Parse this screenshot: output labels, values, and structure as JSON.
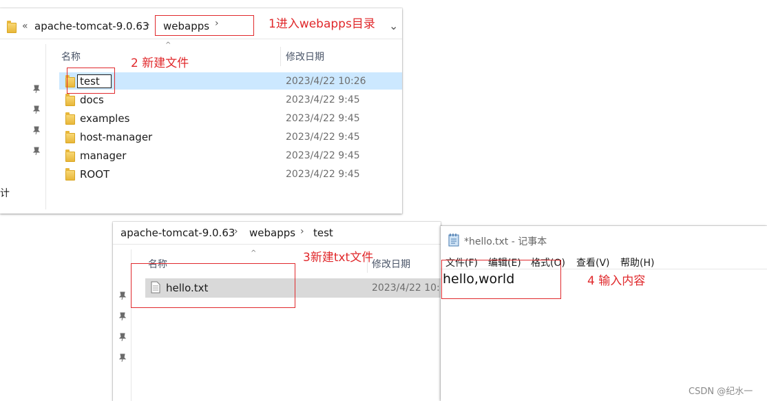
{
  "explorer1": {
    "breadcrumb": [
      "apache-tomcat-9.0.63",
      "webapps"
    ],
    "overflow_symbol": "«",
    "header_name": "名称",
    "header_date": "修改日期",
    "side_fragment": "计",
    "rows": [
      {
        "name": "test",
        "date": "2023/4/22 10:26"
      },
      {
        "name": "docs",
        "date": "2023/4/22 9:45"
      },
      {
        "name": "examples",
        "date": "2023/4/22 9:45"
      },
      {
        "name": "host-manager",
        "date": "2023/4/22 9:45"
      },
      {
        "name": "manager",
        "date": "2023/4/22 9:45"
      },
      {
        "name": "ROOT",
        "date": "2023/4/22 9:45"
      }
    ]
  },
  "explorer2": {
    "breadcrumb": [
      "apache-tomcat-9.0.63",
      "webapps",
      "test"
    ],
    "header_name": "名称",
    "header_date": "修改日期",
    "rows": [
      {
        "name": "hello.txt",
        "date": "2023/4/22 10:"
      }
    ]
  },
  "notepad": {
    "title": "*hello.txt - 记事本",
    "menu": [
      "文件(F)",
      "编辑(E)",
      "格式(O)",
      "查看(V)",
      "帮助(H)"
    ],
    "content": "hello,world"
  },
  "annotations": {
    "step1": "1进入webapps目录",
    "step2": "2 新建文件",
    "step3": "3新建txt文件",
    "step4": "4 输入内容"
  },
  "watermark": "CSDN @纪水一",
  "colors": {
    "annotation_red": "#e0282b",
    "selected_row": "#cce8ff",
    "file_row": "#d9d9d9"
  }
}
